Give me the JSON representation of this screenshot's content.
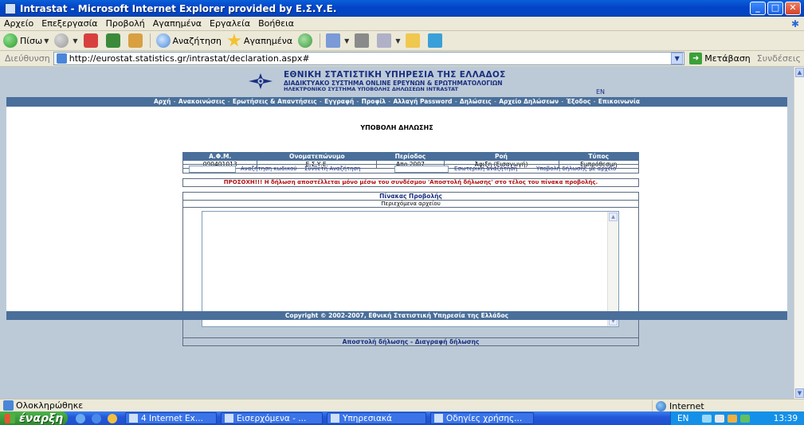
{
  "window": {
    "title": "Intrastat - Microsoft Internet Explorer provided by Ε.Σ.Υ.Ε."
  },
  "menu": [
    "Αρχείο",
    "Επεξεργασία",
    "Προβολή",
    "Αγαπημένα",
    "Εργαλεία",
    "Βοήθεια"
  ],
  "toolbar": {
    "back_label": "Πίσω",
    "search_label": "Αναζήτηση",
    "favorites_label": "Αγαπημένα"
  },
  "address": {
    "label": "Διεύθυνση",
    "url": "http://eurostat.statistics.gr/intrastat/declaration.aspx#",
    "go_label": "Μετάβαση",
    "links_label": "Συνδέσεις"
  },
  "site": {
    "org_line1": "ΕΘΝΙΚΗ ΣΤΑΤΙΣΤΙΚΗ ΥΠΗΡΕΣΙΑ ΤΗΣ ΕΛΛΑΔΟΣ",
    "org_line2": "ΔΙΑΔΙΚΤΥΑΚΟ ΣΥΣΤΗΜΑ ONLINE ΕΡΕΥΝΩΝ & ΕΡΩΤΗΜΑΤΟΛΟΓΙΩΝ",
    "org_line3": "ΗΛΕΚΤΡΟΝΙΚΟ ΣΥΣΤΗΜΑ ΥΠΟΒΟΛΗΣ ΔΗΛΩΣΕΩΝ INTRASTAT",
    "lang": "EN"
  },
  "nav": [
    "Αρχή",
    "Ανακοινώσεις",
    "Ερωτήσεις & Απαντήσεις",
    "Εγγραφή",
    "Προφίλ",
    "Αλλαγή Password",
    "Δηλώσεις",
    "Αρχείο Δηλώσεων",
    "Έξοδος",
    "Επικοινωνία"
  ],
  "page": {
    "title": "ΥΠΟΒΟΛΗ ΔΗΛΩΣΗΣ"
  },
  "info_table": {
    "headers": [
      "Α.Φ.Μ.",
      "Ονοματεπώνυμο",
      "Περίοδος",
      "Ροή",
      "Τύπος"
    ],
    "row": [
      "090401013",
      "Ε.Σ.Υ.Ε.",
      "Απρ 2007",
      "Άφιξη (Εισαγωγή)",
      "Εμπρόθεσμη"
    ]
  },
  "search": {
    "code_search": "Αναζήτηση κωδικού",
    "composite_search": "Σύνθετη Αναζήτηση",
    "internal_search": "Εσωτερική αναζήτηση",
    "file_submit": "Υποβολή δήλωσης με αρχείο"
  },
  "warning": "ΠΡΟΣΟΧΗ!!! Η δήλωση αποστέλλεται μόνο μέσω του συνδέσμου 'Αποστολή δήλωσης' στο τέλος του πίνακα προβολής.",
  "preview": {
    "title": "Πίνακας Προβολής",
    "subtitle": "Περιεχόμενα αρχείου",
    "content": "",
    "send_link": "Αποστολή δήλωσης",
    "delete_link": "Διαγραφή δήλωσης"
  },
  "footer": {
    "copyright": "Copyright © 2002-2007, Εθνική Στατιστική Υπηρεσία της Ελλάδος"
  },
  "status": {
    "text": "Ολοκληρώθηκε",
    "zone": "Internet"
  },
  "taskbar": {
    "start": "έναρξη",
    "tasks": [
      "4 Internet Ex...",
      "Εισερχόμενα - ...",
      "Υπηρεσιακά",
      "Οδηγίες χρήσης..."
    ],
    "lang": "EN",
    "clock": "13:39"
  },
  "colors": {
    "page_background": "#bccad8",
    "nav_bar": "#4a6f9a",
    "org_text": "#1a2f80",
    "warning_text": "#b01010"
  }
}
